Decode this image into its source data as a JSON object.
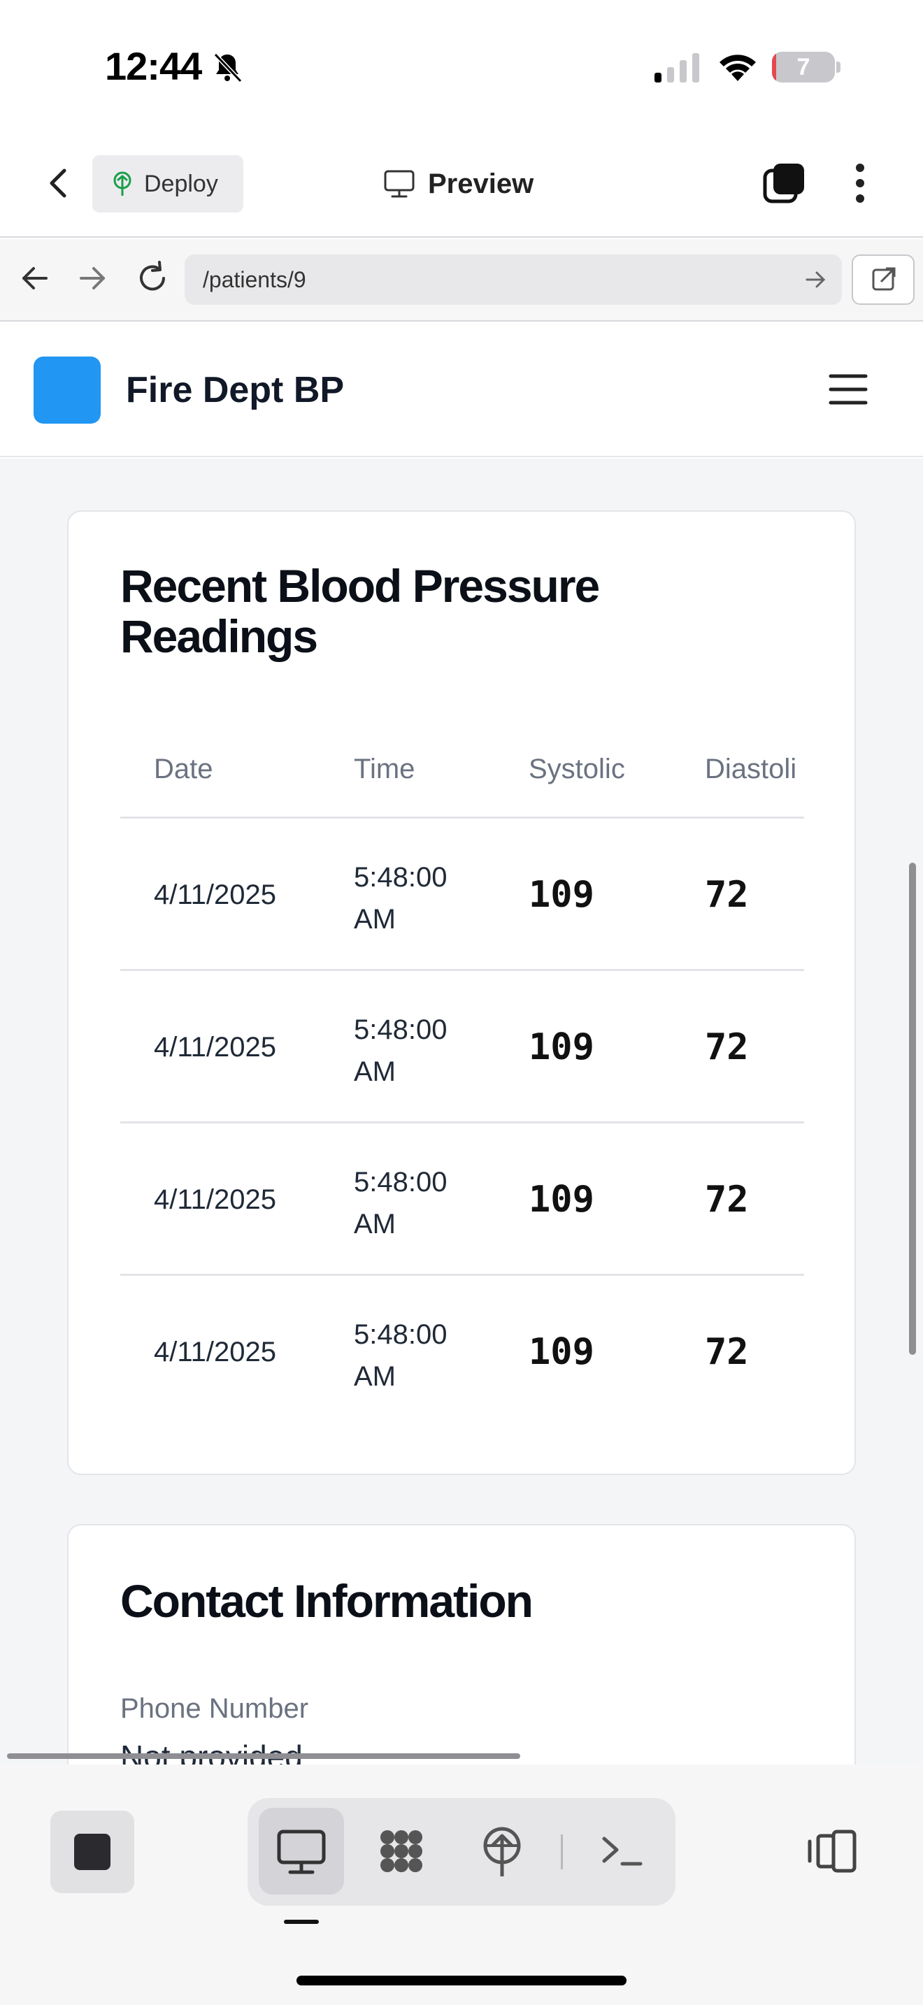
{
  "status_bar": {
    "time": "12:44",
    "battery_level": "7",
    "battery_fraction": 0.07,
    "icons": [
      "bell-slash-icon",
      "cellular-signal-icon",
      "wifi-icon",
      "battery-icon"
    ]
  },
  "app_bar": {
    "deploy_label": "Deploy",
    "preview_label": "Preview",
    "icons": [
      "chevron-left-icon",
      "deploy-tree-icon",
      "monitor-icon",
      "tabs-icon",
      "more-vertical-icon"
    ]
  },
  "browser": {
    "url": "/patients/9",
    "icons": [
      "arrow-left-icon",
      "arrow-right-icon",
      "reload-icon",
      "go-arrow-icon",
      "external-link-icon"
    ]
  },
  "site": {
    "title": "Fire Dept BP",
    "logo_color": "#2196f3"
  },
  "readings_card": {
    "title": "Recent Blood Pressure Readings",
    "columns": [
      "Date",
      "Time",
      "Systolic",
      "Diastoli"
    ],
    "rows": [
      {
        "date": "4/11/2025",
        "time": "5:48:00 AM",
        "systolic": "109",
        "diastolic": "72"
      },
      {
        "date": "4/11/2025",
        "time": "5:48:00 AM",
        "systolic": "109",
        "diastolic": "72"
      },
      {
        "date": "4/11/2025",
        "time": "5:48:00 AM",
        "systolic": "109",
        "diastolic": "72"
      },
      {
        "date": "4/11/2025",
        "time": "5:48:00 AM",
        "systolic": "109",
        "diastolic": "72"
      }
    ]
  },
  "contact_card": {
    "title": "Contact Information",
    "phone_label": "Phone Number",
    "phone_value": "Not provided"
  },
  "bottom_bar": {
    "icons": [
      "stop-icon",
      "desktop-icon",
      "apps-icon",
      "deploy-tree-icon",
      "terminal-icon",
      "panel-toggle-icon"
    ]
  }
}
